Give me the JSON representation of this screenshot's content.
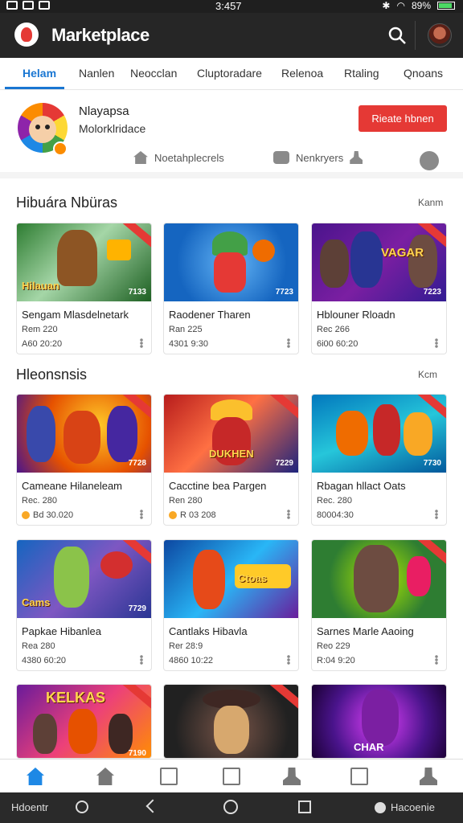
{
  "status_bar": {
    "time": "3:457",
    "battery": "89%"
  },
  "app": {
    "title": "Marketplace"
  },
  "tabs": [
    {
      "label": "Helam",
      "active": true
    },
    {
      "label": "Nanlen",
      "active": false
    },
    {
      "label": "Neocclan",
      "active": false
    },
    {
      "label": "Cluptoradare",
      "active": false
    },
    {
      "label": "Relenoa",
      "active": false
    },
    {
      "label": "Rtaling",
      "active": false
    },
    {
      "label": "Qnoans",
      "active": false
    }
  ],
  "store": {
    "name": "Nlayapsa",
    "subtitle": "Molorklridace",
    "follow_label": "Rieate hbnen",
    "actions": {
      "marketplace": "Noetahplecrels",
      "chat": "Nenkryers"
    }
  },
  "sections": [
    {
      "title": "Hibuára Nbüras",
      "more": "Kanm",
      "cards": [
        {
          "title": "Sengam Mlasdelnetark",
          "price": "Rem 220",
          "meta": "A60 20:20",
          "thumb_caption": "Hilauan",
          "thumb_count": "7133",
          "coin": false
        },
        {
          "title": "Raodener Tharen",
          "price": "Ran 225",
          "meta": "4301 9:30",
          "thumb_caption": "",
          "thumb_count": "7723",
          "coin": false
        },
        {
          "title": "Hblouner Rloadn",
          "price": "Rec 266",
          "meta": "6i00 60:20",
          "thumb_caption": "VAGAR",
          "thumb_count": "7223",
          "coin": false
        }
      ]
    },
    {
      "title": "Hleonsnsis",
      "more": "Kcm",
      "cards": [
        {
          "title": "Cameane Hilaneleam",
          "price": "Rec. 280",
          "meta": "",
          "thumb_caption": "",
          "thumb_count": "7728",
          "coin": true,
          "coin_text": "Bd 30.020"
        },
        {
          "title": "Cacctine bea Pargen",
          "price": "Ren 280",
          "meta": "",
          "thumb_caption": "DUKHEN",
          "thumb_count": "7229",
          "coin": true,
          "coin_text": "R 03 208"
        },
        {
          "title": "Rbagan hllact Oats",
          "price": "Rec. 280",
          "meta": "80004:30",
          "thumb_caption": "",
          "thumb_count": "7730",
          "coin": false
        }
      ]
    },
    {
      "title": "",
      "more": "",
      "cards": [
        {
          "title": "Papkae Hibanlea",
          "price": "Rea 280",
          "meta": "4380 60:20",
          "thumb_caption": "Cams",
          "thumb_count": "7729",
          "coin": false
        },
        {
          "title": "Cantlaks Hibavla",
          "price": "Rer 28:9",
          "meta": "4860 10:22",
          "thumb_caption": "Ctoas",
          "thumb_count": "",
          "coin": false
        },
        {
          "title": "Sarnes Marle Aaoing",
          "price": "Reo 229",
          "meta": "R:04 9:20",
          "thumb_caption": "",
          "thumb_count": "",
          "coin": false
        }
      ]
    },
    {
      "title": "",
      "more": "",
      "cards": [
        {
          "title": "",
          "price": "",
          "meta": "",
          "thumb_caption": "KELKAS",
          "thumb_count": "7190",
          "coin": false
        },
        {
          "title": "",
          "price": "",
          "meta": "",
          "thumb_caption": "",
          "thumb_count": "",
          "coin": false
        },
        {
          "title": "",
          "price": "",
          "meta": "",
          "thumb_caption": "CHAR",
          "thumb_count": "",
          "coin": false
        }
      ]
    }
  ],
  "bottom_nav": [
    "home-icon",
    "store-icon",
    "box-icon",
    "bookmark-icon",
    "user-icon",
    "doc-icon",
    "profile-icon"
  ],
  "system_bar": {
    "left_label": "Hdoentr",
    "right_label": "Hacoenie"
  },
  "colors": {
    "accent": "#1976d2",
    "follow": "#e53935",
    "appbar": "#262626"
  }
}
